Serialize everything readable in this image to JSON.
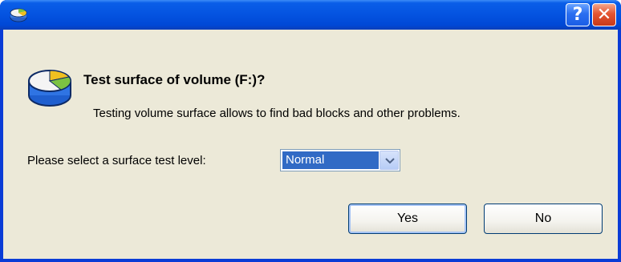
{
  "window": {
    "app_icon": "disk-app-icon",
    "help_button_label": "?",
    "close_button_label": "✕"
  },
  "dialog": {
    "icon": "disk-test-icon",
    "heading": "Test surface of volume (F:)?",
    "description": "Testing volume surface allows to find bad blocks and other problems.",
    "level_label": "Please select a surface test level:",
    "level_selected": "Normal"
  },
  "buttons": {
    "yes_label": "Yes",
    "no_label": "No"
  },
  "colors": {
    "titlebar": "#0453e0",
    "client_bg": "#ece9d8",
    "select_highlight": "#316ac5"
  }
}
